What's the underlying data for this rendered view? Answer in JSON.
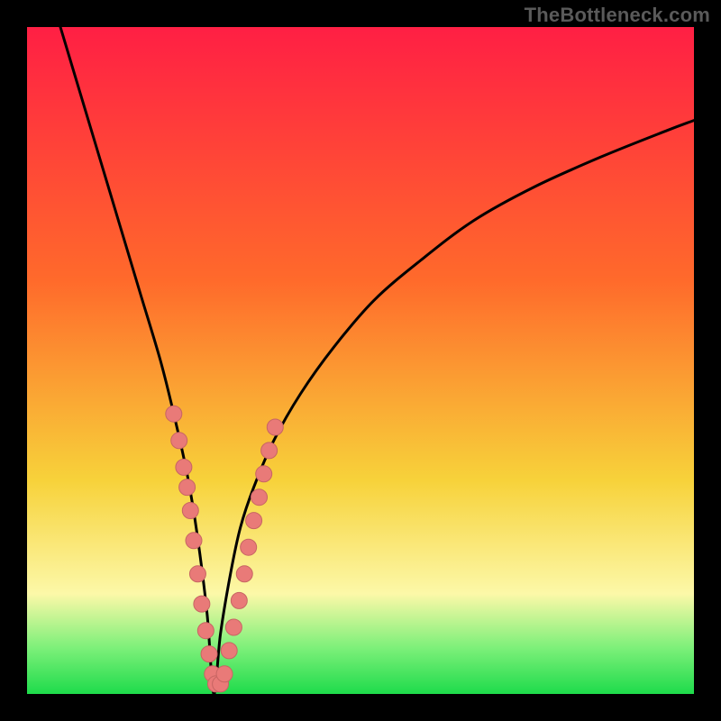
{
  "watermark": "TheBottleneck.com",
  "colors": {
    "frame": "#000000",
    "grad_top": "#ff1f44",
    "grad_mid1": "#ff6a2b",
    "grad_mid2": "#f7d23a",
    "grad_band_light": "#fcf8a8",
    "grad_green_light": "#7ef07a",
    "grad_green": "#1edb4b",
    "curve": "#000000",
    "marker_fill": "#e97a78",
    "marker_stroke": "#c76563"
  },
  "chart_data": {
    "type": "line",
    "title": "",
    "xlabel": "",
    "ylabel": "",
    "xlim": [
      0,
      100
    ],
    "ylim": [
      0,
      100
    ],
    "x_at_min": 28,
    "series": [
      {
        "name": "bottleneck-curve",
        "x": [
          5,
          8,
          11,
          14,
          17,
          20,
          22,
          24,
          25.5,
          27,
          28,
          29,
          30.5,
          32,
          34,
          37,
          41,
          46,
          52,
          59,
          67,
          76,
          86,
          96,
          100
        ],
        "y": [
          100,
          90,
          80,
          70,
          60,
          50,
          42,
          33,
          24,
          12,
          0,
          9,
          18,
          25,
          31,
          38,
          45,
          52,
          59,
          65,
          71,
          76,
          80.5,
          84.5,
          86
        ]
      }
    ],
    "markers": {
      "name": "highlighted-points",
      "points": [
        {
          "x": 22.0,
          "y": 42.0
        },
        {
          "x": 22.8,
          "y": 38.0
        },
        {
          "x": 23.5,
          "y": 34.0
        },
        {
          "x": 24.0,
          "y": 31.0
        },
        {
          "x": 24.5,
          "y": 27.5
        },
        {
          "x": 25.0,
          "y": 23.0
        },
        {
          "x": 25.6,
          "y": 18.0
        },
        {
          "x": 26.2,
          "y": 13.5
        },
        {
          "x": 26.8,
          "y": 9.5
        },
        {
          "x": 27.3,
          "y": 6.0
        },
        {
          "x": 27.8,
          "y": 3.0
        },
        {
          "x": 28.3,
          "y": 1.5
        },
        {
          "x": 29.0,
          "y": 1.5
        },
        {
          "x": 29.6,
          "y": 3.0
        },
        {
          "x": 30.3,
          "y": 6.5
        },
        {
          "x": 31.0,
          "y": 10.0
        },
        {
          "x": 31.8,
          "y": 14.0
        },
        {
          "x": 32.6,
          "y": 18.0
        },
        {
          "x": 33.2,
          "y": 22.0
        },
        {
          "x": 34.0,
          "y": 26.0
        },
        {
          "x": 34.8,
          "y": 29.5
        },
        {
          "x": 35.5,
          "y": 33.0
        },
        {
          "x": 36.3,
          "y": 36.5
        },
        {
          "x": 37.2,
          "y": 40.0
        }
      ]
    }
  }
}
